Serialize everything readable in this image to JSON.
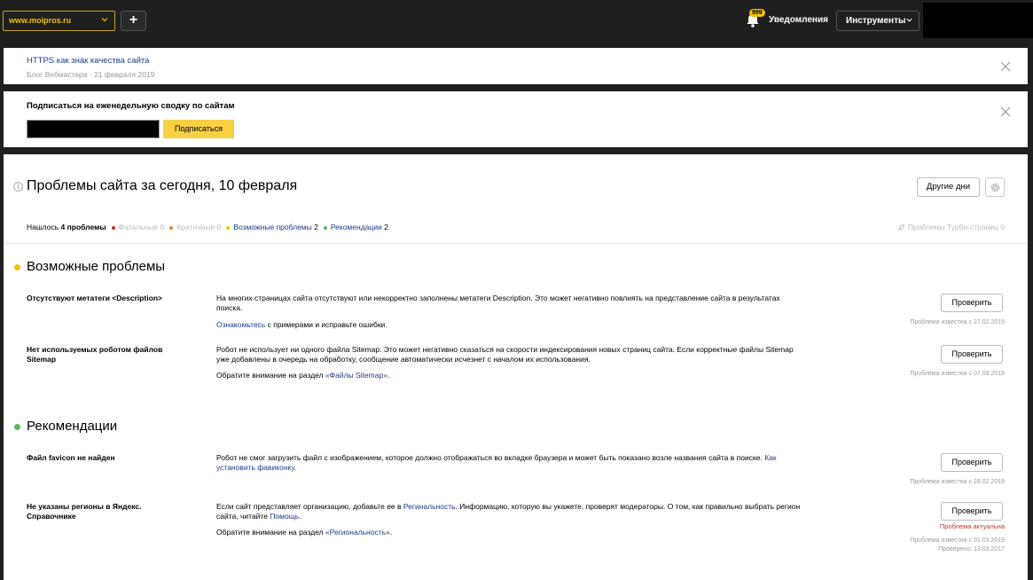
{
  "header": {
    "site": "www.moipros.ru",
    "add_label": "+",
    "notif_count": "999",
    "notif_label": "Уведомления",
    "tools_label": "Инструменты"
  },
  "blog": {
    "link": "HTTPS как знак качества сайта",
    "meta": "Блог Вебмастера · 21 февраля 2019"
  },
  "subscribe": {
    "title": "Подписаться на еженедельную сводку по сайтам",
    "button": "Подписаться"
  },
  "problems": {
    "title": "Проблемы сайта за сегодня, 10 февраля",
    "other_days": "Другие дни",
    "summary": {
      "found_prefix": "Нашлось",
      "found_count": "4 проблемы",
      "fatal": "Фатальные 0",
      "critical": "Критичные 0",
      "possible": "Возможные проблемы",
      "possible_count": "2",
      "recommend": "Рекомендации",
      "recommend_count": "2",
      "turbo": "Проблемы Турбо-страниц 0"
    },
    "colors": {
      "fatal": "#c0392b",
      "critical": "#e67e22",
      "possible": "#f2c200",
      "recommend": "#5cb85c"
    }
  },
  "sections": {
    "possible": {
      "title": "Возможные проблемы",
      "items": [
        {
          "name": "Отсутствуют метатеги <Description>",
          "desc": "На многих страницах сайта отсутствуют или некорректно заполнены метатеги Description. Это может негативно повлиять на представление сайта в результатах поиска.",
          "extra_link": "Ознакомьтесь",
          "extra_text": " с примерами и исправьте ошибки.",
          "button": "Проверить",
          "known": "Проблема известна с 27.02.2019"
        },
        {
          "name": "Нет используемых роботом файлов Sitemap",
          "desc": "Робот не использует ни одного файла Sitemap. Это может негативно сказаться на скорости индексирования новых страниц сайта. Если корректные файлы Sitemap уже добавлены в очередь на обработку, сообщение автоматически исчезнет с началом их использования.",
          "extra_text": "Обратите внимание на раздел ",
          "extra_link": "«Файлы Sitemap»",
          "extra_tail": ".",
          "button": "Проверить",
          "known": "Проблема известна с 07.09.2019"
        }
      ]
    },
    "recommend": {
      "title": "Рекомендации",
      "items": [
        {
          "name": "Файл favicon не найден",
          "desc": "Робот не смог загрузить файл с изображением, которое должно отображаться во вкладке браузера и может быть показано возле названия сайта в поиске. ",
          "desc_link": "Как установить фавиконку.",
          "button": "Проверить",
          "known": "Проблема известна с 28.02.2019"
        },
        {
          "name": "Не указаны регионы в Яндекс. Справочнике",
          "desc": "Если сайт представляет организацию, добавьте ее в ",
          "desc_link": "Регинальность",
          "desc_mid": ". Информацию, которую вы укажете, проверят модераторы. О том, как правильно выбрать регион сайта, читайте ",
          "desc_link2": "Помощь",
          "desc_tail": ".",
          "extra_text": "Обратите внимание на раздел ",
          "extra_link": "«Региональность»",
          "extra_tail": ".",
          "button": "Проверить",
          "status": "Проблема актуальна",
          "known": "Проблема известна с 01.03.2019",
          "checked": "Проверено: 13.03.2017"
        }
      ]
    }
  }
}
